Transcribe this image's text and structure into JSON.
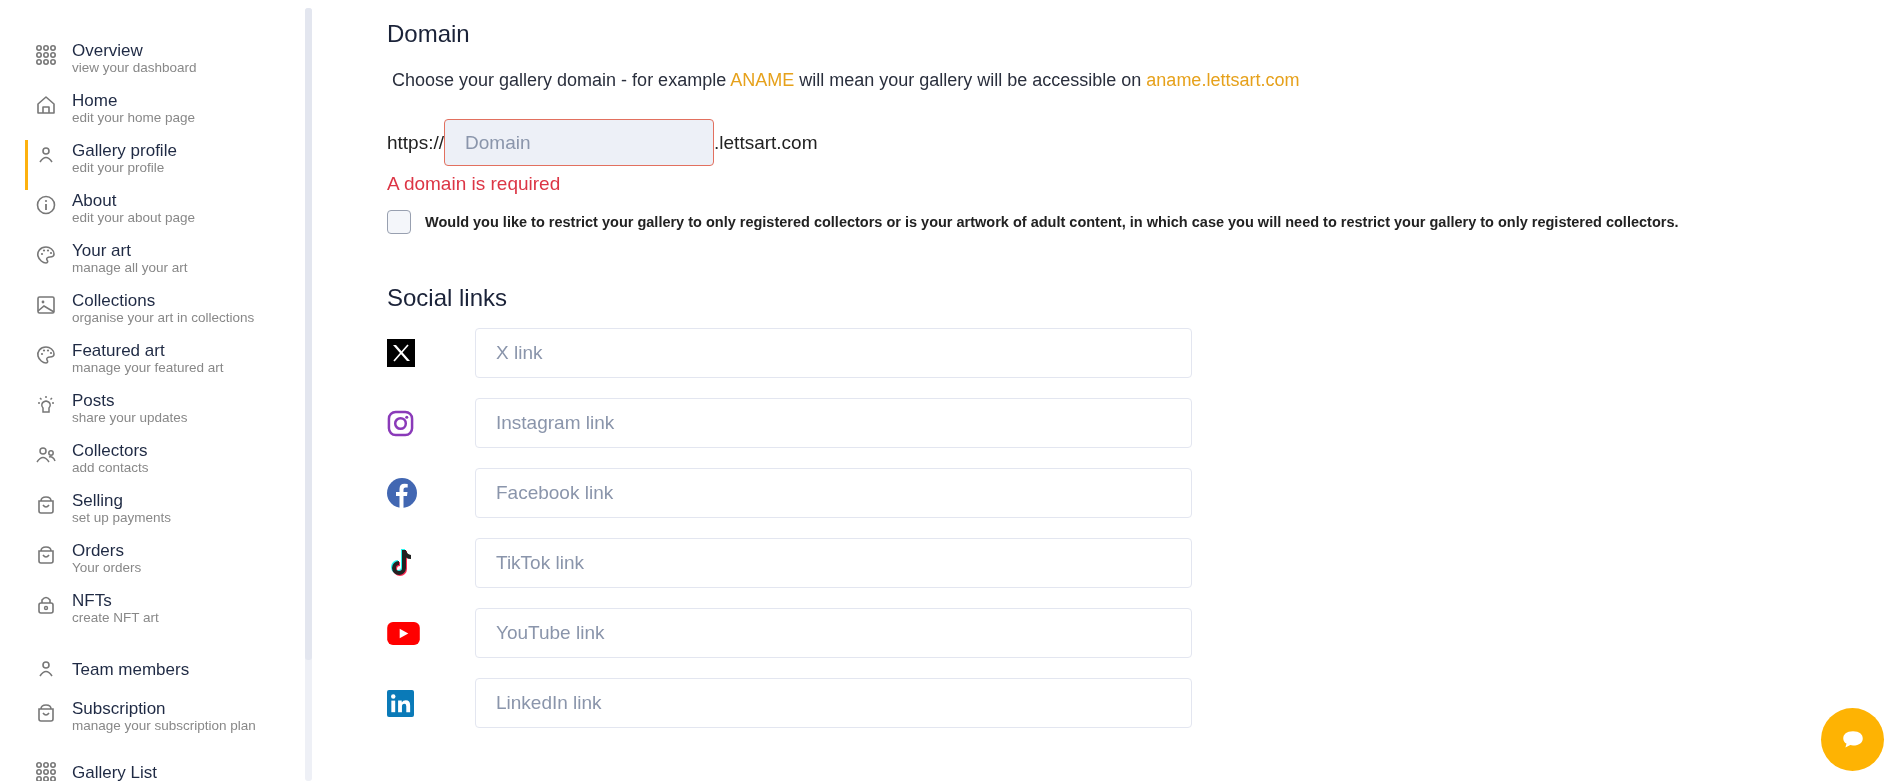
{
  "sidebar": {
    "items": [
      {
        "title": "Overview",
        "subtitle": "view your dashboard",
        "selected": false
      },
      {
        "title": "Home",
        "subtitle": "edit your home page",
        "selected": false
      },
      {
        "title": "Gallery profile",
        "subtitle": "edit your profile",
        "selected": true
      },
      {
        "title": "About",
        "subtitle": "edit your about page",
        "selected": false
      },
      {
        "title": "Your art",
        "subtitle": "manage all your art",
        "selected": false
      },
      {
        "title": "Collections",
        "subtitle": "organise your art in collections",
        "selected": false
      },
      {
        "title": "Featured art",
        "subtitle": "manage your featured art",
        "selected": false
      },
      {
        "title": "Posts",
        "subtitle": "share your updates",
        "selected": false
      },
      {
        "title": "Collectors",
        "subtitle": "add contacts",
        "selected": false
      },
      {
        "title": "Selling",
        "subtitle": "set up payments",
        "selected": false
      },
      {
        "title": "Orders",
        "subtitle": "Your orders",
        "selected": false
      },
      {
        "title": "NFTs",
        "subtitle": "create NFT art",
        "selected": false
      },
      {
        "title": "Team members",
        "selected": false
      },
      {
        "title": "Subscription",
        "subtitle": "manage your subscription plan",
        "selected": false
      },
      {
        "title": "Gallery List",
        "selected": false
      }
    ]
  },
  "domain": {
    "heading": "Domain",
    "description": [
      {
        "text": "Choose your gallery domain - for example ",
        "highlight": false
      },
      {
        "text": "ANAME",
        "highlight": true
      },
      {
        "text": " will mean your gallery will be accessible on ",
        "highlight": false
      },
      {
        "text": "aname.lettsart.com",
        "highlight": true
      }
    ],
    "prefix": "https://",
    "field": {
      "placeholder": "Domain",
      "invalid": true
    },
    "suffix": ".lettsart.com",
    "error": "A domain is required",
    "restrict": {
      "checked": false,
      "label": "Would you like to restrict your gallery to only registered collectors or is your artwork of adult content, in which case you will need to restrict your gallery to only registered collectors."
    }
  },
  "social": {
    "heading": "Social links",
    "links": [
      {
        "placeholder": "X link"
      },
      {
        "placeholder": "Instagram link"
      },
      {
        "placeholder": "Facebook link"
      },
      {
        "placeholder": "TikTok link"
      },
      {
        "placeholder": "YouTube link"
      },
      {
        "placeholder": "LinkedIn link"
      }
    ]
  }
}
